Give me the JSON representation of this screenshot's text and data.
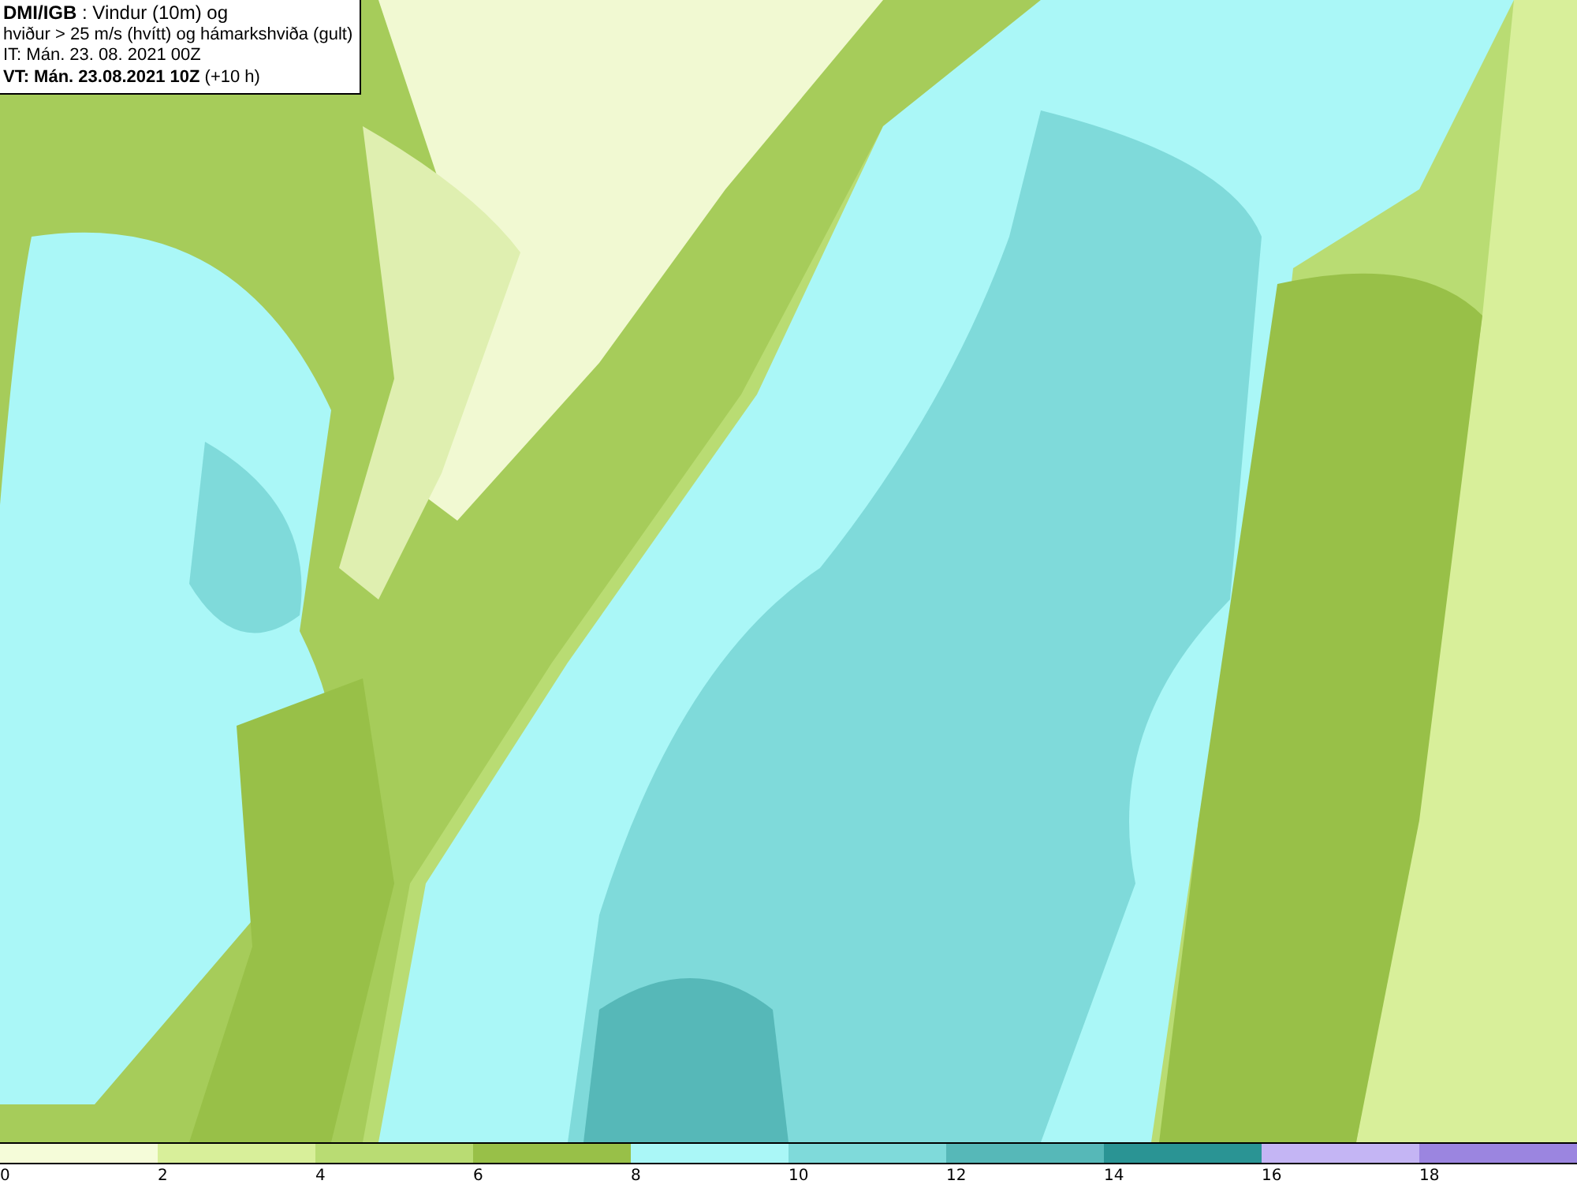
{
  "info_box": {
    "lines": [
      "**DMI/IGB** : Vindur (10m) og",
      "hviður > 25 m/s (hvítt) og hámarkshviða (gult)",
      "IT: Mán. 23. 08. 2021 00Z",
      "**VT: Mán. 23.08.2021 10Z** (+10 h)"
    ]
  },
  "legend": {
    "bins": [
      {
        "color": "#f5fcd9",
        "label": "0"
      },
      {
        "color": "#d8ef9a",
        "label": "2"
      },
      {
        "color": "#b9dc73",
        "label": "4"
      },
      {
        "color": "#98c048",
        "label": "6"
      },
      {
        "color": "#aaf7f7",
        "label": "8"
      },
      {
        "color": "#7fdada",
        "label": "10"
      },
      {
        "color": "#56b8b8",
        "label": "12"
      },
      {
        "color": "#2a9494",
        "label": "14"
      },
      {
        "color": "#c4b5f4",
        "label": "16"
      },
      {
        "color": "#9b85e0",
        "label": "18"
      }
    ]
  }
}
